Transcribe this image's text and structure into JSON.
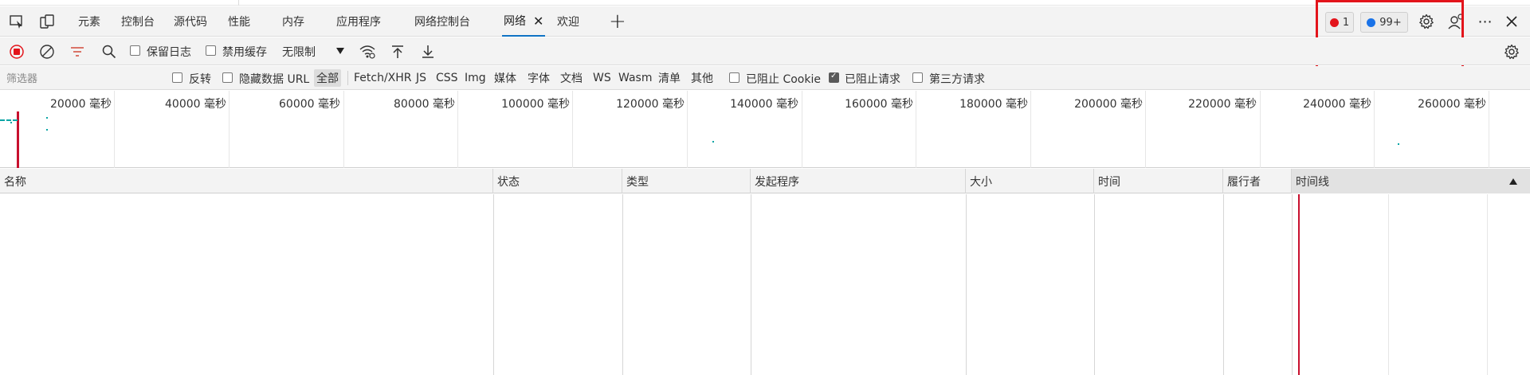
{
  "tabs": [
    {
      "label": "元素"
    },
    {
      "label": "控制台"
    },
    {
      "label": "源代码"
    },
    {
      "label": "性能"
    },
    {
      "label": "内存"
    },
    {
      "label": "应用程序"
    },
    {
      "label": "网络控制台"
    },
    {
      "label": "网络",
      "active": true
    },
    {
      "label": "欢迎"
    }
  ],
  "tab_close_glyph": "✕",
  "add_tab_glyph": "+",
  "badges": {
    "errors": "1",
    "messages": "99+"
  },
  "colors": {
    "error": "#e3141b",
    "info": "#1a73e8",
    "accent": "#0e72c4",
    "highlight_box": "#e3141b",
    "timeline_marker": "#c8102e",
    "overview_dot": "#0aa5a5"
  },
  "toolbar": {
    "preserve_log": "保留日志",
    "disable_cache": "禁用缓存",
    "throttle": "无限制"
  },
  "filter": {
    "placeholder": "筛选器",
    "invert": "反转",
    "hide_data_url": "隐藏数据 URL",
    "types": [
      "全部",
      "Fetch/XHR",
      "JS",
      "CSS",
      "Img",
      "媒体",
      "字体",
      "文档",
      "WS",
      "Wasm",
      "清单",
      "其他"
    ],
    "blocked_cookies": "已阻止 Cookie",
    "blocked_requests": "已阻止请求",
    "third_party": "第三方请求"
  },
  "overview": {
    "ticks": [
      "20000 毫秒",
      "40000 毫秒",
      "60000 毫秒",
      "80000 毫秒",
      "100000 毫秒",
      "120000 毫秒",
      "140000 毫秒",
      "160000 毫秒",
      "180000 毫秒",
      "200000 毫秒",
      "220000 毫秒",
      "240000 毫秒",
      "260000 毫秒"
    ]
  },
  "table": {
    "columns": [
      "名称",
      "状态",
      "类型",
      "发起程序",
      "大小",
      "时间",
      "履行者",
      "时间线"
    ]
  }
}
